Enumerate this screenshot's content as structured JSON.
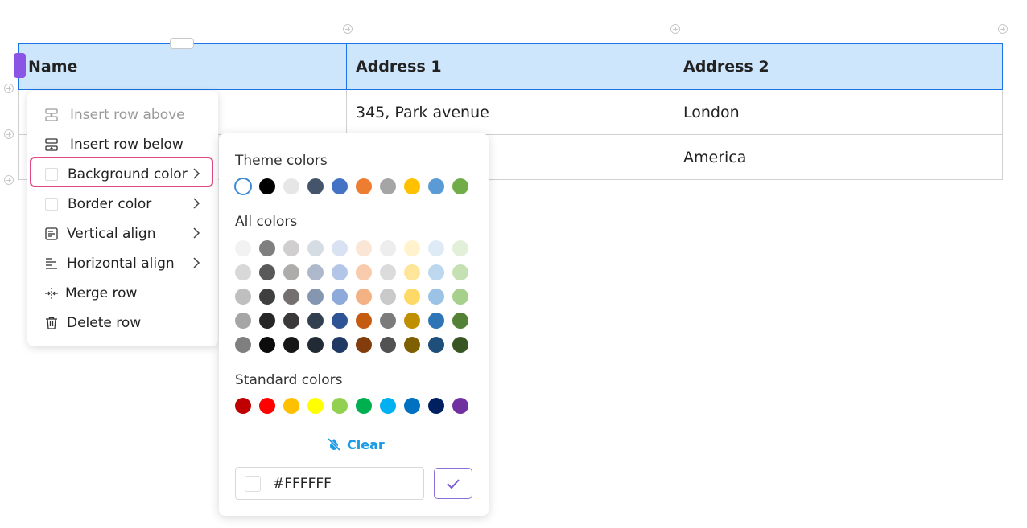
{
  "table": {
    "headers": [
      "Name",
      "Address 1",
      "Address 2"
    ],
    "rows": [
      [
        "",
        "345, Park avenue",
        "London"
      ],
      [
        "",
        "",
        "America"
      ]
    ]
  },
  "context_menu": {
    "items": [
      {
        "label": "Insert row above",
        "icon": "insert-row-above-icon",
        "disabled": true,
        "submenu": false
      },
      {
        "label": "Insert row below",
        "icon": "insert-row-below-icon",
        "disabled": false,
        "submenu": false
      },
      {
        "label": "Background color",
        "icon": "color-swatch-icon",
        "disabled": false,
        "submenu": true,
        "highlighted": true
      },
      {
        "label": "Border color",
        "icon": "color-swatch-icon",
        "disabled": false,
        "submenu": true
      },
      {
        "label": "Vertical align",
        "icon": "vertical-align-icon",
        "disabled": false,
        "submenu": true
      },
      {
        "label": "Horizontal align",
        "icon": "horizontal-align-icon",
        "disabled": false,
        "submenu": true
      },
      {
        "label": "Merge row",
        "icon": "merge-icon",
        "disabled": false,
        "submenu": false
      },
      {
        "label": "Delete row",
        "icon": "trash-icon",
        "disabled": false,
        "submenu": false
      }
    ],
    "highlight_color": "#e24983"
  },
  "color_panel": {
    "theme_title": "Theme colors",
    "theme_colors": [
      "#ffffff",
      "#000000",
      "#e7e6e6",
      "#44546a",
      "#4472c4",
      "#ed7d31",
      "#a5a5a5",
      "#ffc000",
      "#5b9bd5",
      "#70ad47"
    ],
    "all_title": "All colors",
    "all_colors": [
      [
        "#f2f2f2",
        "#7f7f7f",
        "#d0cece",
        "#d6dce4",
        "#d9e2f3",
        "#fbe5d5",
        "#ededed",
        "#fff2cc",
        "#deebf6",
        "#e2efd9"
      ],
      [
        "#d8d8d8",
        "#595959",
        "#aeabab",
        "#adb9ca",
        "#b4c6e7",
        "#f7cbac",
        "#dbdbdb",
        "#fee599",
        "#bdd7ee",
        "#c5e0b3"
      ],
      [
        "#bfbfbf",
        "#3f3f3f",
        "#757070",
        "#8496b0",
        "#8eaadb",
        "#f4b183",
        "#c9c9c9",
        "#ffd965",
        "#9cc3e5",
        "#a8d08d"
      ],
      [
        "#a5a5a5",
        "#262626",
        "#3a3838",
        "#323f4f",
        "#2f5496",
        "#c55a11",
        "#7b7b7b",
        "#bf8f00",
        "#2e75b5",
        "#538135"
      ],
      [
        "#7f7f7f",
        "#0c0c0c",
        "#171616",
        "#222a35",
        "#1f3864",
        "#833c0b",
        "#525252",
        "#7f6000",
        "#1e4e79",
        "#375623"
      ]
    ],
    "standard_title": "Standard colors",
    "standard_colors": [
      "#c00000",
      "#ff0000",
      "#ffc000",
      "#ffff00",
      "#92d050",
      "#00b050",
      "#00b0f0",
      "#0070c0",
      "#002060",
      "#7030a0"
    ],
    "clear_label": "Clear",
    "hex_value": "#FFFFFF",
    "accent_color": "#1a9be6"
  }
}
